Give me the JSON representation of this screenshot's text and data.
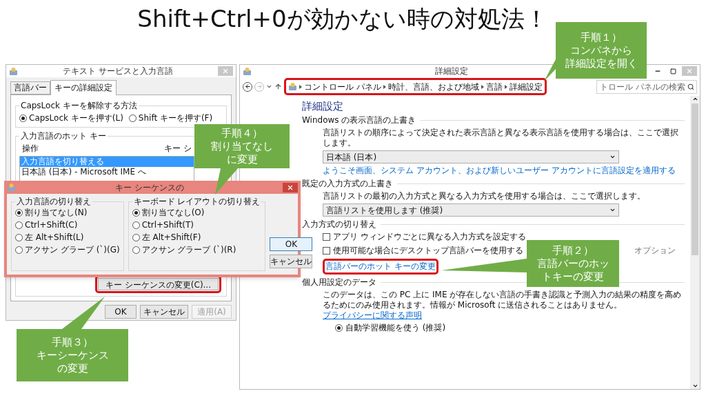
{
  "slide_title": "Shift+Ctrl+0が効かない時の対処法！",
  "text_services_window": {
    "title": "テキスト サービスと入力言語",
    "tabs": [
      {
        "label": "言語バー",
        "selected": false
      },
      {
        "label": "キーの詳細設定",
        "selected": true
      }
    ],
    "capslock_group": {
      "title": "CapsLock キーを解除する方法",
      "options": [
        {
          "label": "CapsLock キーを押す(L)",
          "selected": true
        },
        {
          "label": "Shift キーを押す(F)",
          "selected": false
        }
      ]
    },
    "hotkey_group": {
      "title": "入力言語のホット キー",
      "columns": [
        "操作",
        "キー シ"
      ],
      "rows": [
        {
          "action": "入力言語を切り替える",
          "selected": true
        },
        {
          "action": "日本語 (日本) - Microsoft IME へ",
          "selected": false
        }
      ],
      "change_button": {
        "label": "キー シーケンスの変更(C)...",
        "highlighted": true
      }
    },
    "buttons": [
      {
        "label": "OK",
        "disabled": false
      },
      {
        "label": "キャンセル",
        "disabled": false
      },
      {
        "label": "適用(A)",
        "disabled": true
      }
    ]
  },
  "key_sequence_dialog": {
    "title": "キー シーケンスの",
    "groups": [
      {
        "title": "入力言語の切り替え",
        "options": [
          {
            "label": "割り当てなし(N)",
            "selected": true
          },
          {
            "label": "Ctrl+Shift(C)",
            "selected": false
          },
          {
            "label": "左 Alt+Shift(L)",
            "selected": false
          },
          {
            "label": "アクサン グラーブ (`)(G)",
            "selected": false
          }
        ]
      },
      {
        "title": "キーボード レイアウトの切り替え",
        "options": [
          {
            "label": "割り当てなし(O)",
            "selected": true
          },
          {
            "label": "Ctrl+Shift(T)",
            "selected": false
          },
          {
            "label": "左 Alt+Shift(F)",
            "selected": false
          },
          {
            "label": "アクサン グラーブ (`)(R)",
            "selected": false
          }
        ]
      }
    ],
    "buttons": [
      "OK",
      "キャンセル"
    ]
  },
  "advanced_settings_window": {
    "title": "詳細設定",
    "breadcrumb": {
      "items": [
        "コントロール パネル",
        "時計、言語、および地域",
        "言語",
        "詳細設定"
      ],
      "highlighted": true
    },
    "search": {
      "placeholder": "トロール パネルの検索"
    },
    "heading": "詳細設定",
    "sections": [
      {
        "title": "Windows の表示言語の上書き",
        "items": [
          {
            "kind": "text",
            "text": "言語リストの順序によって決定された表示言語と異なる表示言語を使用する場合は、ここで選択します。"
          },
          {
            "kind": "dropdown",
            "value": "日本語 (日本)"
          },
          {
            "kind": "link",
            "text": "ようこそ画面、システム アカウント、および新しいユーザー アカウントに言語設定を適用する",
            "highlighted": false
          }
        ]
      },
      {
        "title": "既定の入力方式の上書き",
        "items": [
          {
            "kind": "text",
            "text": "言語リストの最初の入力方式と異なる入力方式を使用する場合は、ここで選択します。"
          },
          {
            "kind": "dropdown",
            "value": "言語リストを使用します (推奨)"
          }
        ]
      },
      {
        "title": "入力方式の切り替え",
        "items": [
          {
            "kind": "checkbox",
            "label": "アプリ ウィンドウごとに異なる入力方式を設定する",
            "checked": false
          },
          {
            "kind": "checkbox",
            "label": "使用可能な場合にデスクトップ言語バーを使用する",
            "checked": false,
            "aside": "オプション"
          },
          {
            "kind": "link",
            "text": "言語バーのホット キーの変更",
            "highlighted": true
          }
        ]
      },
      {
        "title": "個人用設定のデータ",
        "items": [
          {
            "kind": "text",
            "text": "このデータは、この PC 上に IME が存在しない言語の手書き認識と予測入力の結果の精度を高めるためにのみ使用されます。情報が Microsoft に送信されることはありません。",
            "link": "プライバシーに関する声明"
          },
          {
            "kind": "radio",
            "label": "自動学習機能を使う (推奨)",
            "selected": true
          }
        ]
      }
    ]
  },
  "callouts": [
    {
      "lines": [
        "手順１）",
        "コンパネから",
        "詳細設定を開く"
      ]
    },
    {
      "lines": [
        "手順２）",
        "言語バーのホッ",
        "トキーの変更"
      ]
    },
    {
      "lines": [
        "手順３）",
        "キーシーケンス",
        "の変更"
      ]
    },
    {
      "lines": [
        "手順４）",
        "割り当てなし",
        "に変更"
      ]
    }
  ]
}
